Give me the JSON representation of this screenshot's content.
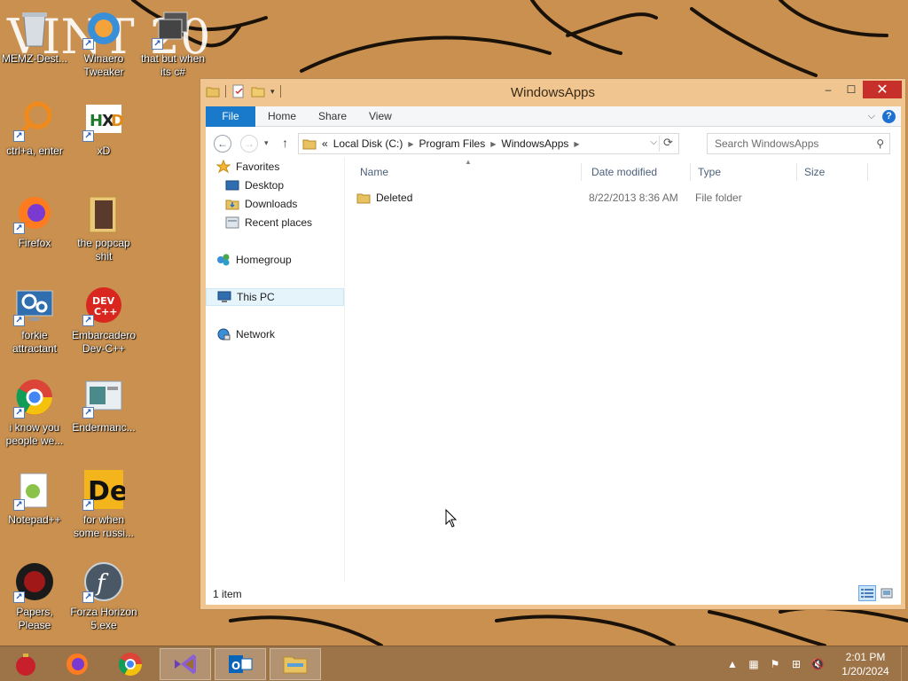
{
  "desktop": {
    "icons": [
      {
        "label": "MEMZ-Dest...",
        "icon": "recycle-bin-icon"
      },
      {
        "label": "Winaero Tweaker",
        "icon": "winaero-icon"
      },
      {
        "label": "that but when its c#",
        "icon": "windows-stack-icon"
      },
      {
        "label": "ctrl+a, enter",
        "icon": "magnifier-ring-icon"
      },
      {
        "label": "xD",
        "icon": "hxd-icon"
      },
      {
        "label": "Firefox",
        "icon": "firefox-icon"
      },
      {
        "label": "the popcap shit",
        "icon": "folder-icon"
      },
      {
        "label": "forkie attractant",
        "icon": "settings-monitor-icon"
      },
      {
        "label": "Embarcadero Dev-C++",
        "icon": "devcpp-icon"
      },
      {
        "label": "i know you people we...",
        "icon": "chrome-icon"
      },
      {
        "label": "Endermanc...",
        "icon": "window-app-icon"
      },
      {
        "label": "Notepad++",
        "icon": "notepadpp-icon"
      },
      {
        "label": "for when some russi...",
        "icon": "de-icon"
      },
      {
        "label": "Papers, Please",
        "icon": "papers-please-icon"
      },
      {
        "label": "Forza Horizon 5.exe",
        "icon": "flash-icon"
      }
    ]
  },
  "window": {
    "title": "WindowsApps",
    "controls": {
      "minimize": "–",
      "maximize": "☐",
      "close": "✕"
    },
    "ribbon_tabs": [
      "File",
      "Home",
      "Share",
      "View"
    ],
    "help": "?",
    "address": {
      "overflow": "«",
      "crumbs": [
        "Local Disk (C:)",
        "Program Files",
        "WindowsApps"
      ]
    },
    "search_placeholder": "Search WindowsApps",
    "nav": {
      "favorites": "Favorites",
      "desktop": "Desktop",
      "downloads": "Downloads",
      "recent": "Recent places",
      "homegroup": "Homegroup",
      "thispc": "This PC",
      "network": "Network"
    },
    "columns": [
      "Name",
      "Date modified",
      "Type",
      "Size"
    ],
    "files": [
      {
        "name": "Deleted",
        "date": "8/22/2013 8:36 AM",
        "type": "File folder",
        "size": ""
      }
    ],
    "status": "1 item"
  },
  "taskbar": {
    "apps": [
      "ornament-icon",
      "firefox-icon",
      "chrome-icon",
      "visual-studio-icon",
      "outlook-icon",
      "file-explorer-icon"
    ],
    "clock": {
      "time": "2:01 PM",
      "date": "1/20/2024"
    }
  },
  "colors": {
    "wallpaper": "#c9904f",
    "taskbar": "#9d7448",
    "window_frame": "#f0c58f",
    "file_tab": "#1979ca",
    "close_button": "#c7302a"
  }
}
